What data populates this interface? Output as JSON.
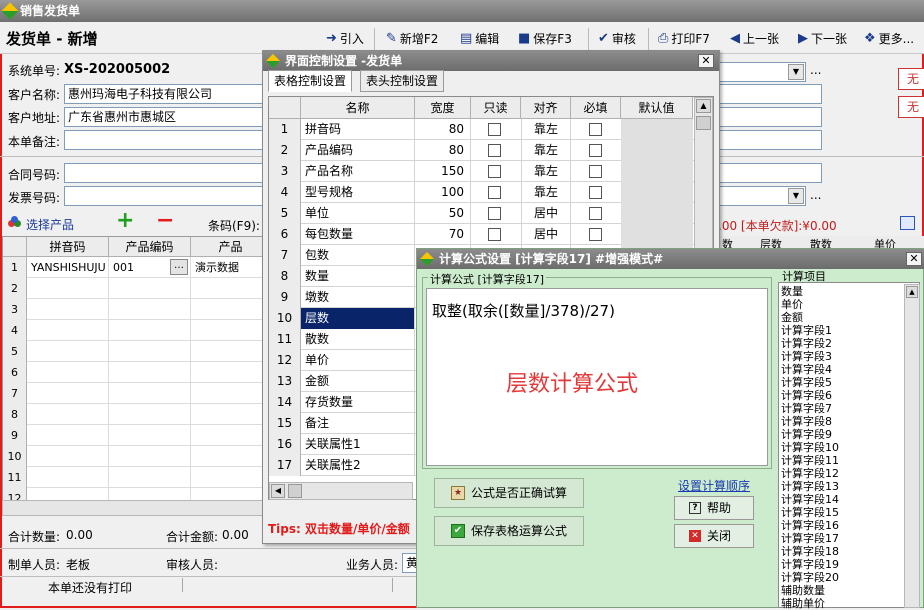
{
  "window": {
    "title": "销售发货单"
  },
  "form": {
    "title": "发货单 - 新增"
  },
  "toolbar": {
    "import": "引入",
    "new": "新增F2",
    "edit": "编辑",
    "save": "保存F3",
    "audit": "审核",
    "print": "打印F7",
    "prev": "上一张",
    "next": "下一张",
    "more": "更多..."
  },
  "fields": {
    "sys_no_label": "系统单号:",
    "sys_no": "XS-202005002",
    "customer_label": "客户名称:",
    "customer": "惠州玛海电子科技有限公司",
    "address_label": "客户地址:",
    "address": "广东省惠州市惠城区",
    "remark_label": "本单备注:",
    "contract_label": "合同号码:",
    "invoice_label": "发票号码:",
    "ellipsis": "..."
  },
  "side_buttons": [
    "无",
    "无"
  ],
  "product_bar": {
    "select": "选择产品",
    "barcode_label": "条码(F9):",
    "summary": ".00 [本单欠款]:¥0.00"
  },
  "grid": {
    "headers": [
      "拼音码",
      "产品编码",
      "产品"
    ],
    "rows": [
      {
        "no": "1",
        "pinyin": "YANSHISHUJU",
        "code": "001",
        "name": "演示数据"
      },
      {
        "no": "2"
      },
      {
        "no": "3"
      },
      {
        "no": "4"
      },
      {
        "no": "5"
      },
      {
        "no": "6"
      },
      {
        "no": "7"
      },
      {
        "no": "8"
      },
      {
        "no": "9"
      },
      {
        "no": "10"
      },
      {
        "no": "11"
      },
      {
        "no": "12"
      }
    ],
    "right_headers": [
      "数",
      "层数",
      "散数",
      "单价"
    ]
  },
  "footer": {
    "total_qty_label": "合计数量:",
    "total_qty": "0.00",
    "total_amt_label": "合计金额:",
    "total_amt": "0.00",
    "maker_label": "制单人员:",
    "maker": "老板",
    "auditor_label": "审核人员:",
    "sales_label": "业务人员:",
    "sales": "黄",
    "print_status": "本单还没有打印"
  },
  "ui_dialog": {
    "title": "界面控制设置 -发货单",
    "tabs": [
      "表格控制设置",
      "表头控制设置"
    ],
    "headers": [
      "名称",
      "宽度",
      "只读",
      "对齐",
      "必填",
      "默认值"
    ],
    "rows": [
      {
        "no": "1",
        "name": "拼音码",
        "width": "80",
        "align": "靠左"
      },
      {
        "no": "2",
        "name": "产品编码",
        "width": "80",
        "align": "靠左"
      },
      {
        "no": "3",
        "name": "产品名称",
        "width": "150",
        "align": "靠左"
      },
      {
        "no": "4",
        "name": "型号规格",
        "width": "100",
        "align": "靠左"
      },
      {
        "no": "5",
        "name": "单位",
        "width": "50",
        "align": "居中"
      },
      {
        "no": "6",
        "name": "每包数量",
        "width": "70",
        "align": "居中"
      },
      {
        "no": "7",
        "name": "包数"
      },
      {
        "no": "8",
        "name": "数量"
      },
      {
        "no": "9",
        "name": "墩数"
      },
      {
        "no": "10",
        "name": "层数"
      },
      {
        "no": "11",
        "name": "散数"
      },
      {
        "no": "12",
        "name": "单价"
      },
      {
        "no": "13",
        "name": "金额"
      },
      {
        "no": "14",
        "name": "存货数量"
      },
      {
        "no": "15",
        "name": "备注"
      },
      {
        "no": "16",
        "name": "关联属性1"
      },
      {
        "no": "17",
        "name": "关联属性2"
      }
    ],
    "tips": "Tips: 双击数量/单价/金额"
  },
  "formula_dialog": {
    "title": "计算公式设置 [计算字段17]   #增强模式#",
    "group_label": "计算公式 [计算字段17]",
    "formula": "取整(取余([数量]/378)/27)",
    "caption": "层数计算公式",
    "btn_check": "公式是否正确试算",
    "btn_save": "保存表格运算公式",
    "link_order": "设置计算顺序",
    "btn_help": "帮助",
    "btn_close": "关闭",
    "items_label": "计算项目",
    "items": [
      "数量",
      "单价",
      "金额",
      "计算字段1",
      "计算字段2",
      "计算字段3",
      "计算字段4",
      "计算字段5",
      "计算字段6",
      "计算字段7",
      "计算字段8",
      "计算字段9",
      "计算字段10",
      "计算字段11",
      "计算字段12",
      "计算字段13",
      "计算字段14",
      "计算字段15",
      "计算字段16",
      "计算字段17",
      "计算字段18",
      "计算字段19",
      "计算字段20",
      "辅助数量",
      "辅助单价"
    ]
  },
  "colors": {
    "accent_red": "#e21b1b",
    "selection": "#0a246a",
    "dialog_green": "#cdeccd"
  }
}
